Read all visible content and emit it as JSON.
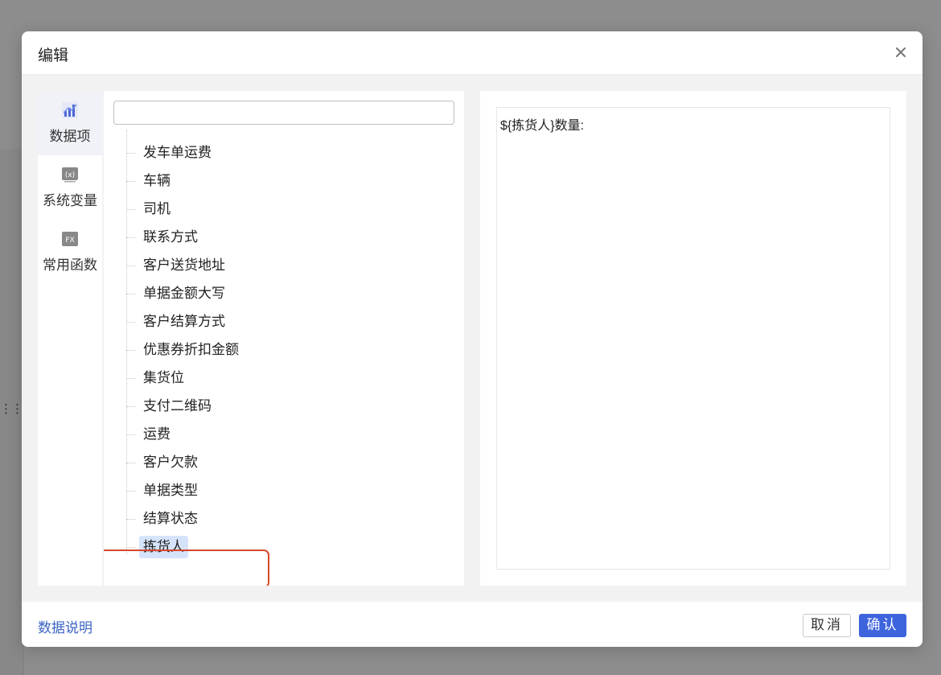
{
  "dialog": {
    "title": "编辑"
  },
  "left_nav": {
    "items": [
      {
        "label": "数据项",
        "icon": "chart-icon",
        "active": true
      },
      {
        "label": "系统变量",
        "icon": "variable-icon",
        "active": false
      },
      {
        "label": "常用函数",
        "icon": "function-icon",
        "active": false
      }
    ]
  },
  "search": {
    "value": "",
    "placeholder": ""
  },
  "tree": {
    "items": [
      "发车单运费",
      "车辆",
      "司机",
      "联系方式",
      "客户送货地址",
      "单据金额大写",
      "客户结算方式",
      "优惠券折扣金额",
      "集货位",
      "支付二维码",
      "运费",
      "客户欠款",
      "单据类型",
      "结算状态",
      "拣货人"
    ],
    "selected": "拣货人"
  },
  "editor": {
    "content": "${拣货人}数量:"
  },
  "footer": {
    "link_label": "数据说明",
    "cancel_label": "取消",
    "ok_label": "确认"
  },
  "colors": {
    "primary": "#3d63dd",
    "link": "#3a63c4",
    "highlight_border": "#d9472b",
    "selected_bg": "#d6e4fb"
  }
}
